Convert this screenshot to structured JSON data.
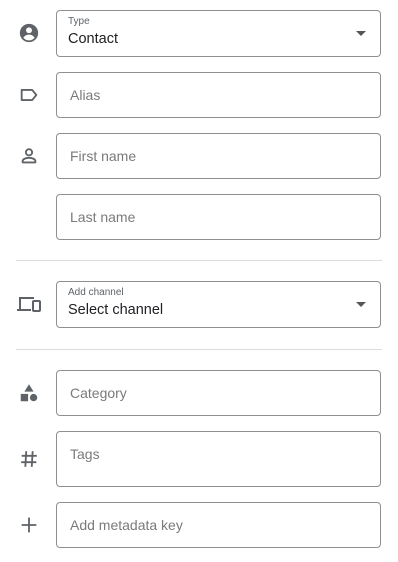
{
  "form": {
    "type": {
      "label": "Type",
      "value": "Contact",
      "icon": "account-circle-icon"
    },
    "alias": {
      "placeholder": "Alias",
      "icon": "label-tag-icon"
    },
    "first_name": {
      "placeholder": "First name",
      "icon": "person-icon"
    },
    "last_name": {
      "placeholder": "Last name"
    },
    "channel": {
      "label": "Add channel",
      "value": "Select channel",
      "icon": "devices-icon"
    },
    "category": {
      "placeholder": "Category",
      "icon": "shapes-icon"
    },
    "tags": {
      "placeholder": "Tags",
      "icon": "hash-icon"
    },
    "metadata": {
      "placeholder": "Add metadata key",
      "icon": "add-icon"
    }
  },
  "colors": {
    "icon": "#5f6368",
    "border": "#8f8f8f",
    "divider": "#dadce0",
    "placeholder": "#7a7a7a"
  }
}
